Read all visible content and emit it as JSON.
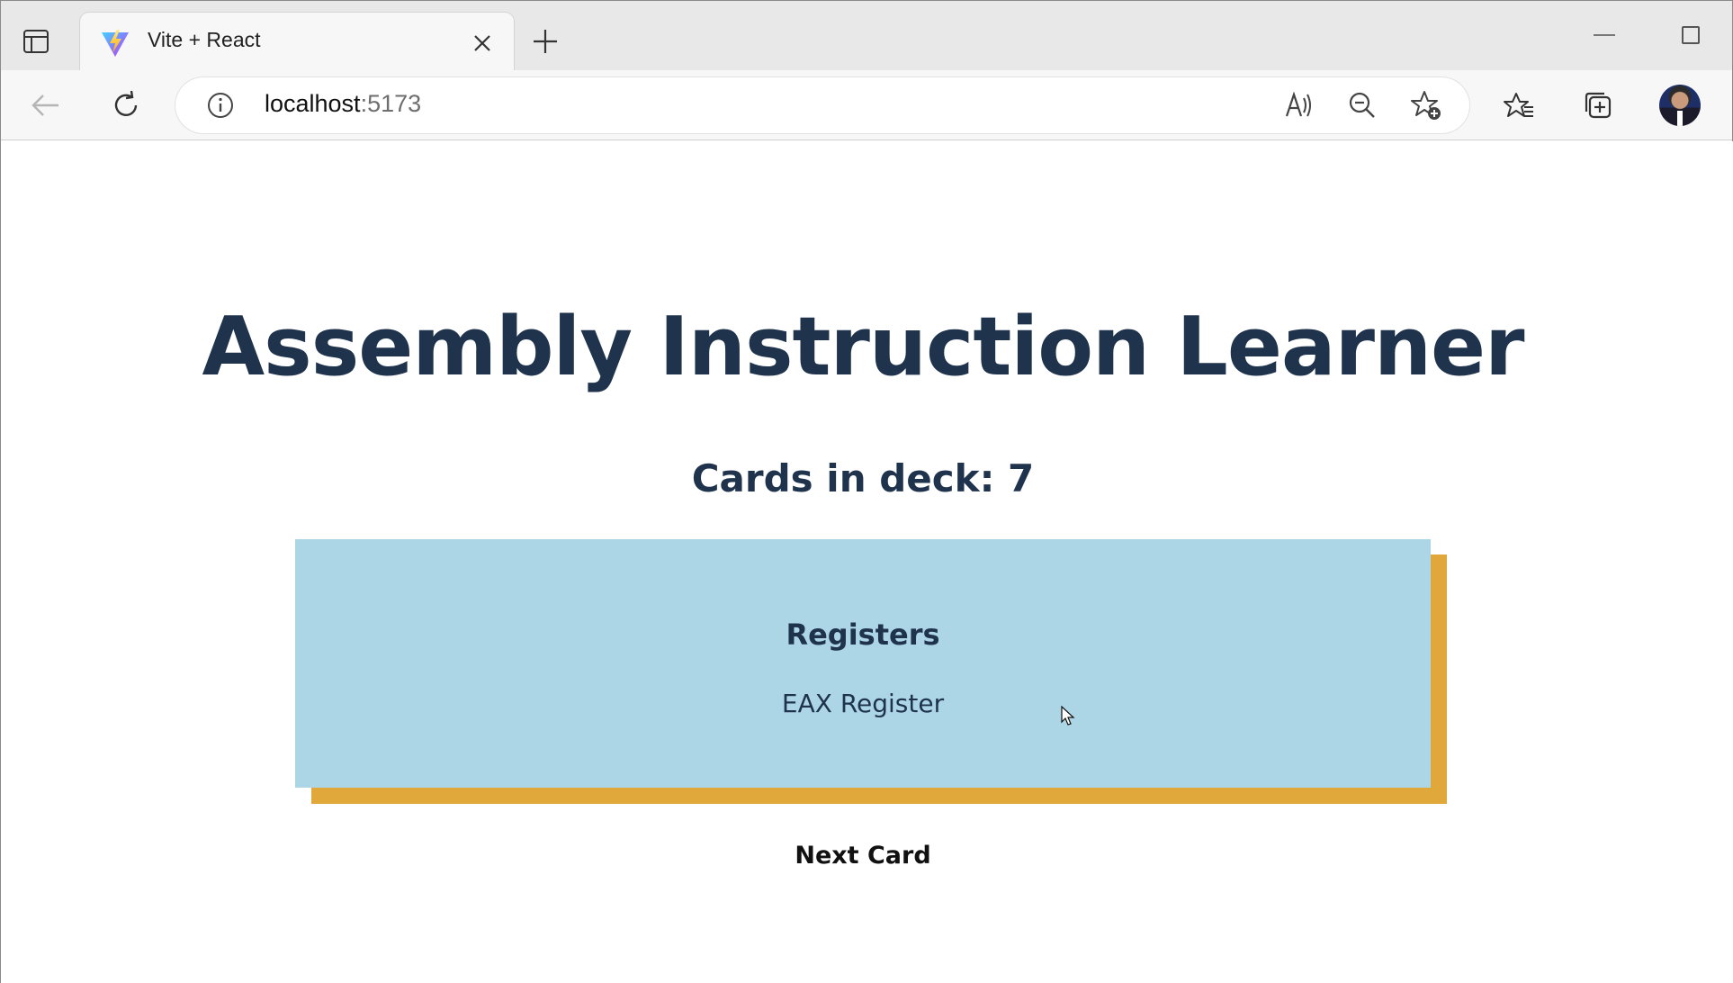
{
  "browser": {
    "tab": {
      "title": "Vite + React",
      "favicon": "vite-logo-icon"
    },
    "address_bar": {
      "host": "localhost",
      "port": ":5173"
    },
    "toolbar_icons": [
      "back-icon",
      "refresh-icon",
      "info-icon",
      "read-aloud-icon",
      "zoom-out-icon",
      "add-favorite-icon",
      "favorites-icon",
      "collections-icon"
    ]
  },
  "app": {
    "title": "Assembly Instruction Learner",
    "deck_count_label": "Cards in deck: 7",
    "card": {
      "category": "Registers",
      "term": "EAX Register"
    },
    "next_button_label": "Next Card"
  },
  "colors": {
    "heading": "#1f334d",
    "card_background": "#acd6e6",
    "card_shadow": "#e0a73b"
  }
}
